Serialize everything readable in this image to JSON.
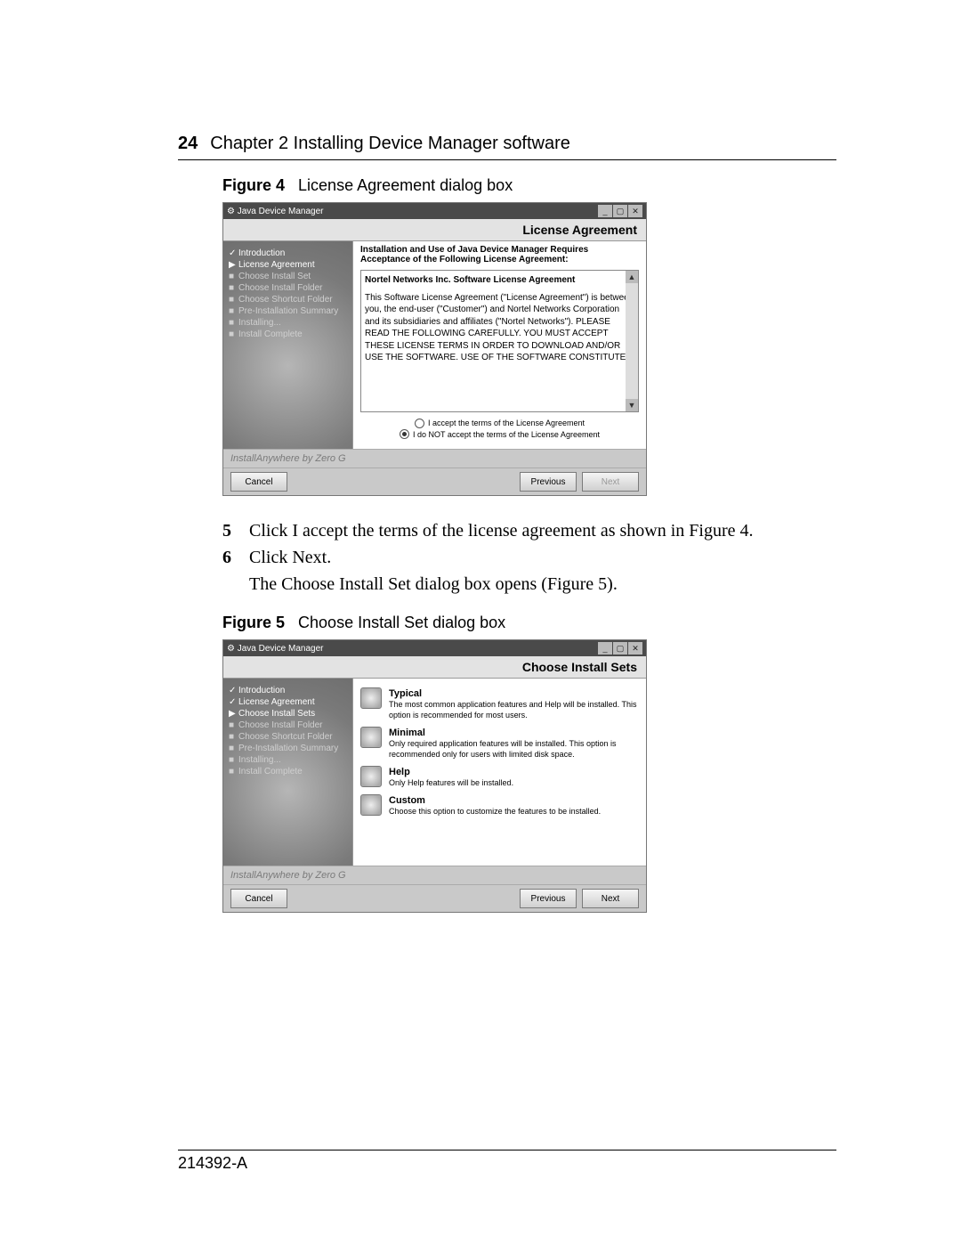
{
  "page": {
    "number": "24",
    "chapter": "Chapter 2  Installing Device Manager software",
    "doc_id": "214392-A"
  },
  "fig4": {
    "label": "Figure 4",
    "caption": "License Agreement dialog box",
    "window_title": "Java Device Manager",
    "banner": "License Agreement",
    "side_items": [
      "Introduction",
      "License Agreement",
      "Choose Install Set",
      "Choose Install Folder",
      "Choose Shortcut Folder",
      "Pre-Installation Summary",
      "Installing...",
      "Install Complete"
    ],
    "intro": "Installation and Use of Java Device Manager Requires Acceptance of the Following License Agreement:",
    "lic_title": "Nortel Networks Inc. Software License Agreement",
    "lic_body": "This Software License Agreement (\"License Agreement\") is between you, the end-user (\"Customer\") and Nortel Networks Corporation and its subsidiaries and affiliates (\"Nortel Networks\"). PLEASE READ THE FOLLOWING CAREFULLY. YOU MUST ACCEPT THESE LICENSE TERMS IN ORDER TO DOWNLOAD AND/OR USE THE SOFTWARE. USE OF THE SOFTWARE CONSTITUTES",
    "radio_accept": "I accept the terms of the License Agreement",
    "radio_reject": "I do NOT accept the terms of the License Agreement",
    "install_anywhere": "InstallAnywhere by Zero G",
    "btn_cancel": "Cancel",
    "btn_prev": "Previous",
    "btn_next": "Next"
  },
  "doc_steps": {
    "s5": "Click I accept the terms of the license agreement as shown in Figure 4.",
    "s6a": "Click Next.",
    "s6b": "The Choose Install Set dialog box opens (Figure 5)."
  },
  "fig5": {
    "label": "Figure 5",
    "caption": "Choose Install Set dialog box",
    "window_title": "Java Device Manager",
    "banner": "Choose Install Sets",
    "side_items": [
      "Introduction",
      "License Agreement",
      "Choose Install Sets",
      "Choose Install Folder",
      "Choose Shortcut Folder",
      "Pre-Installation Summary",
      "Installing...",
      "Install Complete"
    ],
    "opts": [
      {
        "name": "Typical",
        "desc": "The most common application features and Help will be installed. This option is recommended for most users."
      },
      {
        "name": "Minimal",
        "desc": "Only required application features will be installed. This option is recommended only for users with limited disk space."
      },
      {
        "name": "Help",
        "desc": "Only Help features will be installed."
      },
      {
        "name": "Custom",
        "desc": "Choose this option to customize the features to be installed."
      }
    ],
    "install_anywhere": "InstallAnywhere by Zero G",
    "btn_cancel": "Cancel",
    "btn_prev": "Previous",
    "btn_next": "Next"
  }
}
